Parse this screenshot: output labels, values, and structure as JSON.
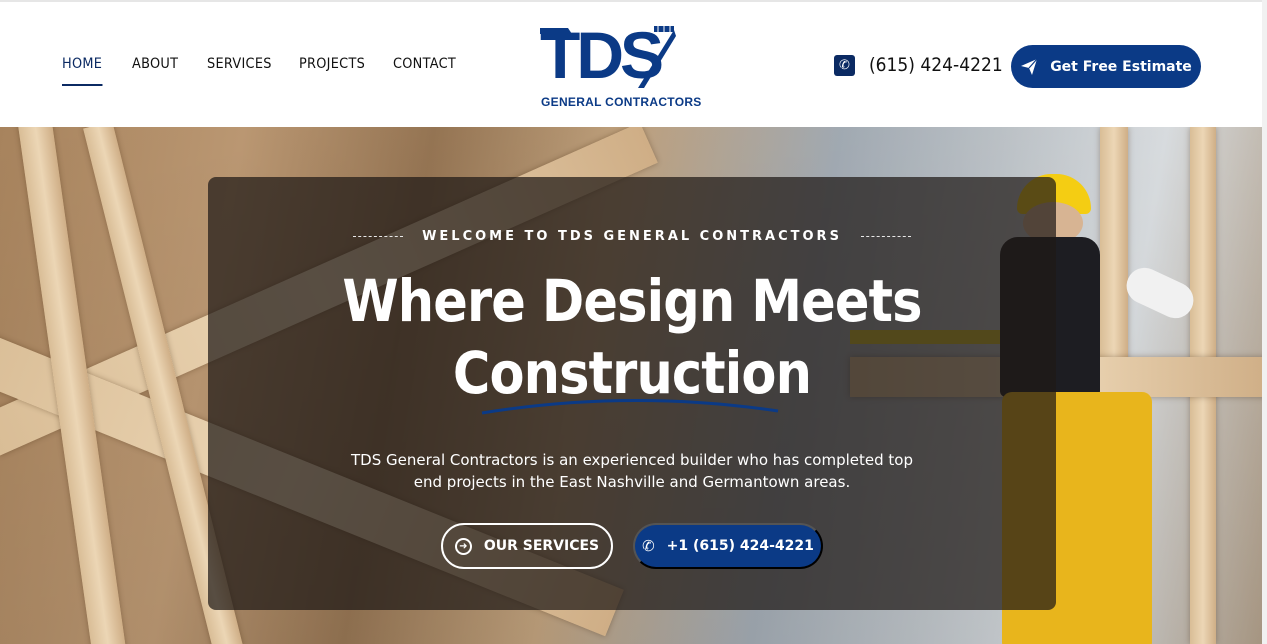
{
  "nav": {
    "items": [
      {
        "label": "HOME",
        "active": true
      },
      {
        "label": "ABOUT",
        "active": false
      },
      {
        "label": "SERVICES",
        "active": false
      },
      {
        "label": "PROJECTS",
        "active": false
      },
      {
        "label": "CONTACT",
        "active": false
      }
    ]
  },
  "logo": {
    "letters": "TDS",
    "subtitle": "GENERAL CONTRACTORS"
  },
  "header": {
    "phone": "(615) 424-4221",
    "cta_label": "Get Free Estimate"
  },
  "hero": {
    "eyebrow": "WELCOME TO TDS GENERAL CONTRACTORS",
    "headline_line1": "Where Design Meets",
    "headline_line2": "Construction",
    "description": "TDS General Contractors is an experienced builder who has completed top end projects in the East Nashville and Germantown areas.",
    "primary_button": "OUR SERVICES",
    "secondary_button": "+1 (615) 424-4221"
  },
  "colors": {
    "brand_navy": "#0b3a86",
    "nav_active": "#0b2a63",
    "hat_yellow": "#f4cd13"
  },
  "icons": [
    "phone-square-icon",
    "paper-plane-icon",
    "arrow-circle-right-icon",
    "phone-ringing-icon"
  ]
}
